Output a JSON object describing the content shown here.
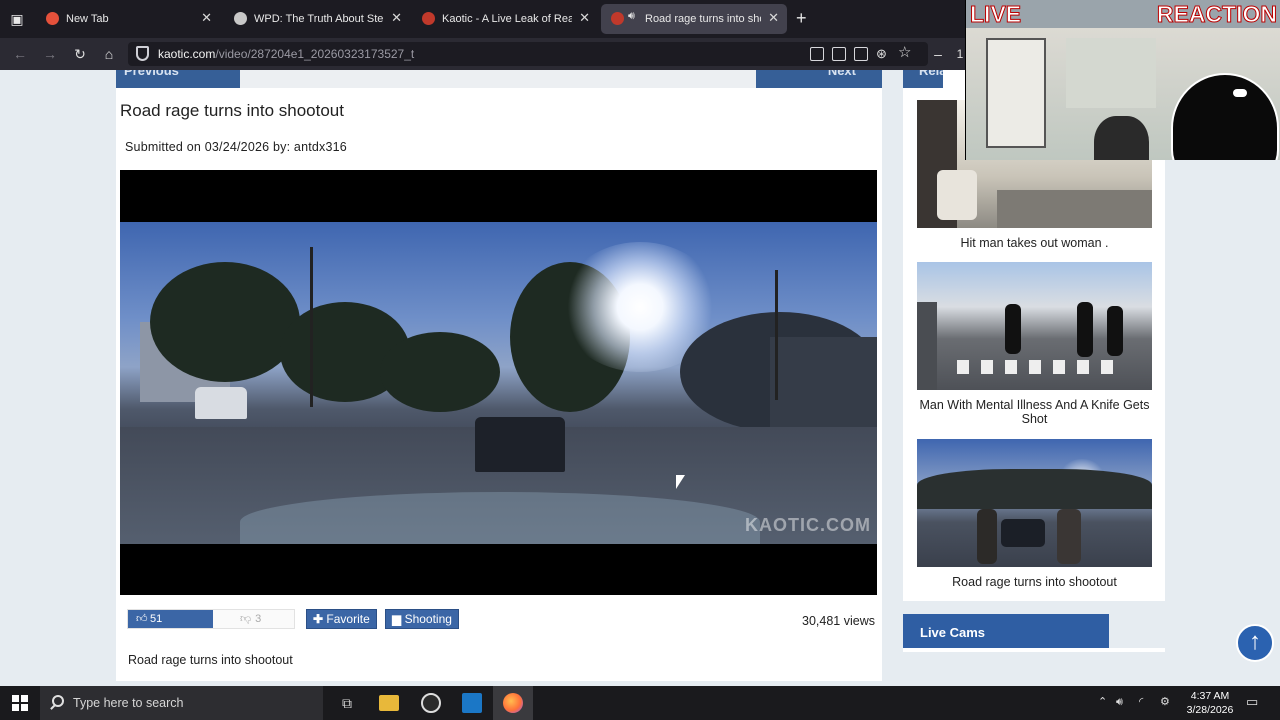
{
  "browser": {
    "tabs": [
      {
        "title": "New Tab",
        "favicon_color": "#e5513b",
        "active": false
      },
      {
        "title": "WPD: The Truth About Stephen",
        "favicon_color": "#c8c8c8",
        "active": false
      },
      {
        "title": "Kaotic - A Live Leak of Reality",
        "favicon_color": "#c0392b",
        "active": false
      },
      {
        "title": "Road rage turns into shooti",
        "favicon_color": "#c0392b",
        "active": true,
        "playing_audio": true
      }
    ],
    "url_domain": "kaotic.com",
    "url_path": "/video/287204e1_20260323173527_t",
    "right_truncated_text": "1"
  },
  "page": {
    "pager": {
      "previous": "Previous",
      "next": "Next"
    },
    "title": "Road rage turns into shootout",
    "submitted": "Submitted on 03/24/2026 by: antdx316",
    "video": {
      "watermark": "KAOTIC.COM"
    },
    "likes": "51",
    "dislikes": "3",
    "favorite_label": "Favorite",
    "category_label": "Shooting",
    "views": "30,481 views",
    "description": "Road rage turns into shootout",
    "sidebar": {
      "heading": "Related",
      "items": [
        {
          "caption": "Hit man takes out woman ."
        },
        {
          "caption": "Man With Mental Illness And A Knife Gets Shot"
        },
        {
          "caption": "Road rage turns into shootout"
        }
      ],
      "live_cams": "Live Cams"
    }
  },
  "overlay": {
    "live": "LIVE",
    "reaction": "REACTION"
  },
  "taskbar": {
    "search_placeholder": "Type here to search",
    "time": "4:37 AM",
    "date": "3/28/2026"
  },
  "colors": {
    "site_blue": "#365f97",
    "button_blue": "#3b66a6",
    "browser_dark": "#1c1b22"
  }
}
